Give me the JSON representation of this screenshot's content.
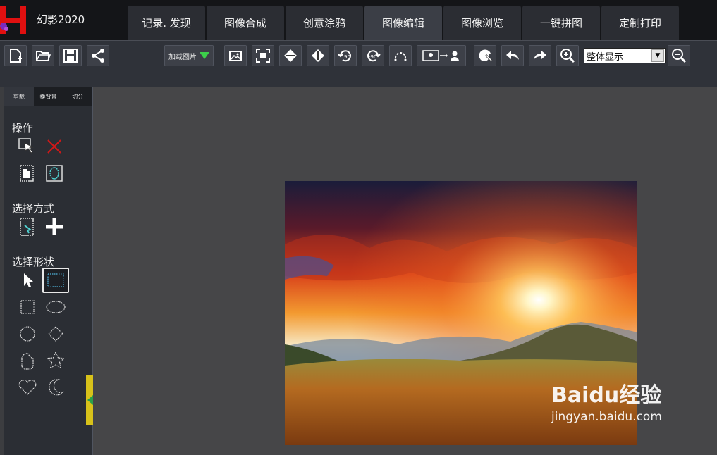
{
  "app": {
    "title": "幻影2020"
  },
  "tabs": [
    {
      "label": "记录. 发现",
      "active": false
    },
    {
      "label": "图像合成",
      "active": false
    },
    {
      "label": "创意涂鸦",
      "active": false
    },
    {
      "label": "图像编辑",
      "active": true
    },
    {
      "label": "图像浏览",
      "active": false
    },
    {
      "label": "一键拼图",
      "active": false
    },
    {
      "label": "定制打印",
      "active": false
    }
  ],
  "toolbar": {
    "load_label": "加载图片",
    "zoom_select": {
      "value": "整体显示"
    }
  },
  "panel": {
    "tabs": [
      {
        "label": "剪裁",
        "active": true
      },
      {
        "label": "换背景",
        "active": false
      },
      {
        "label": "切分",
        "active": false
      }
    ],
    "section_operate": "操作",
    "section_select_mode": "选择方式",
    "section_select_shape": "选择形状"
  },
  "watermark": {
    "main": "Baidu经验",
    "sub": "jingyan.baidu.com"
  },
  "colors": {
    "accent_active_tab": "#3b3e46",
    "handle": "#d8c21a",
    "logo_red": "#e01010",
    "logo_purple": "#7a2bbf"
  }
}
